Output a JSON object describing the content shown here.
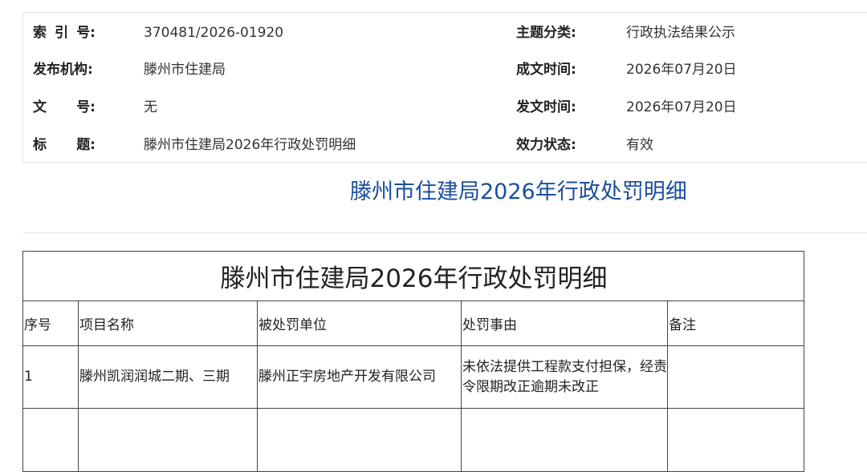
{
  "meta": {
    "index_label": [
      "索",
      "引",
      "号:"
    ],
    "index_value": "370481/2026-01920",
    "category_label": "主题分类:",
    "category_value": "行政执法结果公示",
    "issuer_label": "发布机构:",
    "issuer_value": "滕州市住建局",
    "created_label": "成文时间:",
    "created_value": "2026年07月20日",
    "docno_label": [
      "文",
      "号:"
    ],
    "docno_value": "无",
    "published_label": "发文时间:",
    "published_value": "2026年07月20日",
    "title_label": [
      "标",
      "题:"
    ],
    "title_value": "滕州市住建局2026年行政处罚明细",
    "status_label": "效力状态:",
    "status_value": "有效"
  },
  "page_title": "滕州市住建局2026年行政处罚明细",
  "table": {
    "title": "滕州市住建局2026年行政处罚明细",
    "headers": [
      "序号",
      "项目名称",
      "被处罚单位",
      "处罚事由",
      "备注"
    ],
    "rows": [
      [
        "1",
        "滕州凯润润城二期、三期",
        "滕州正宇房地产开发有限公司",
        "未依法提供工程款支付担保，经责令限期改正逾期未改正",
        ""
      ],
      [
        "",
        "",
        "",
        "",
        ""
      ]
    ]
  }
}
